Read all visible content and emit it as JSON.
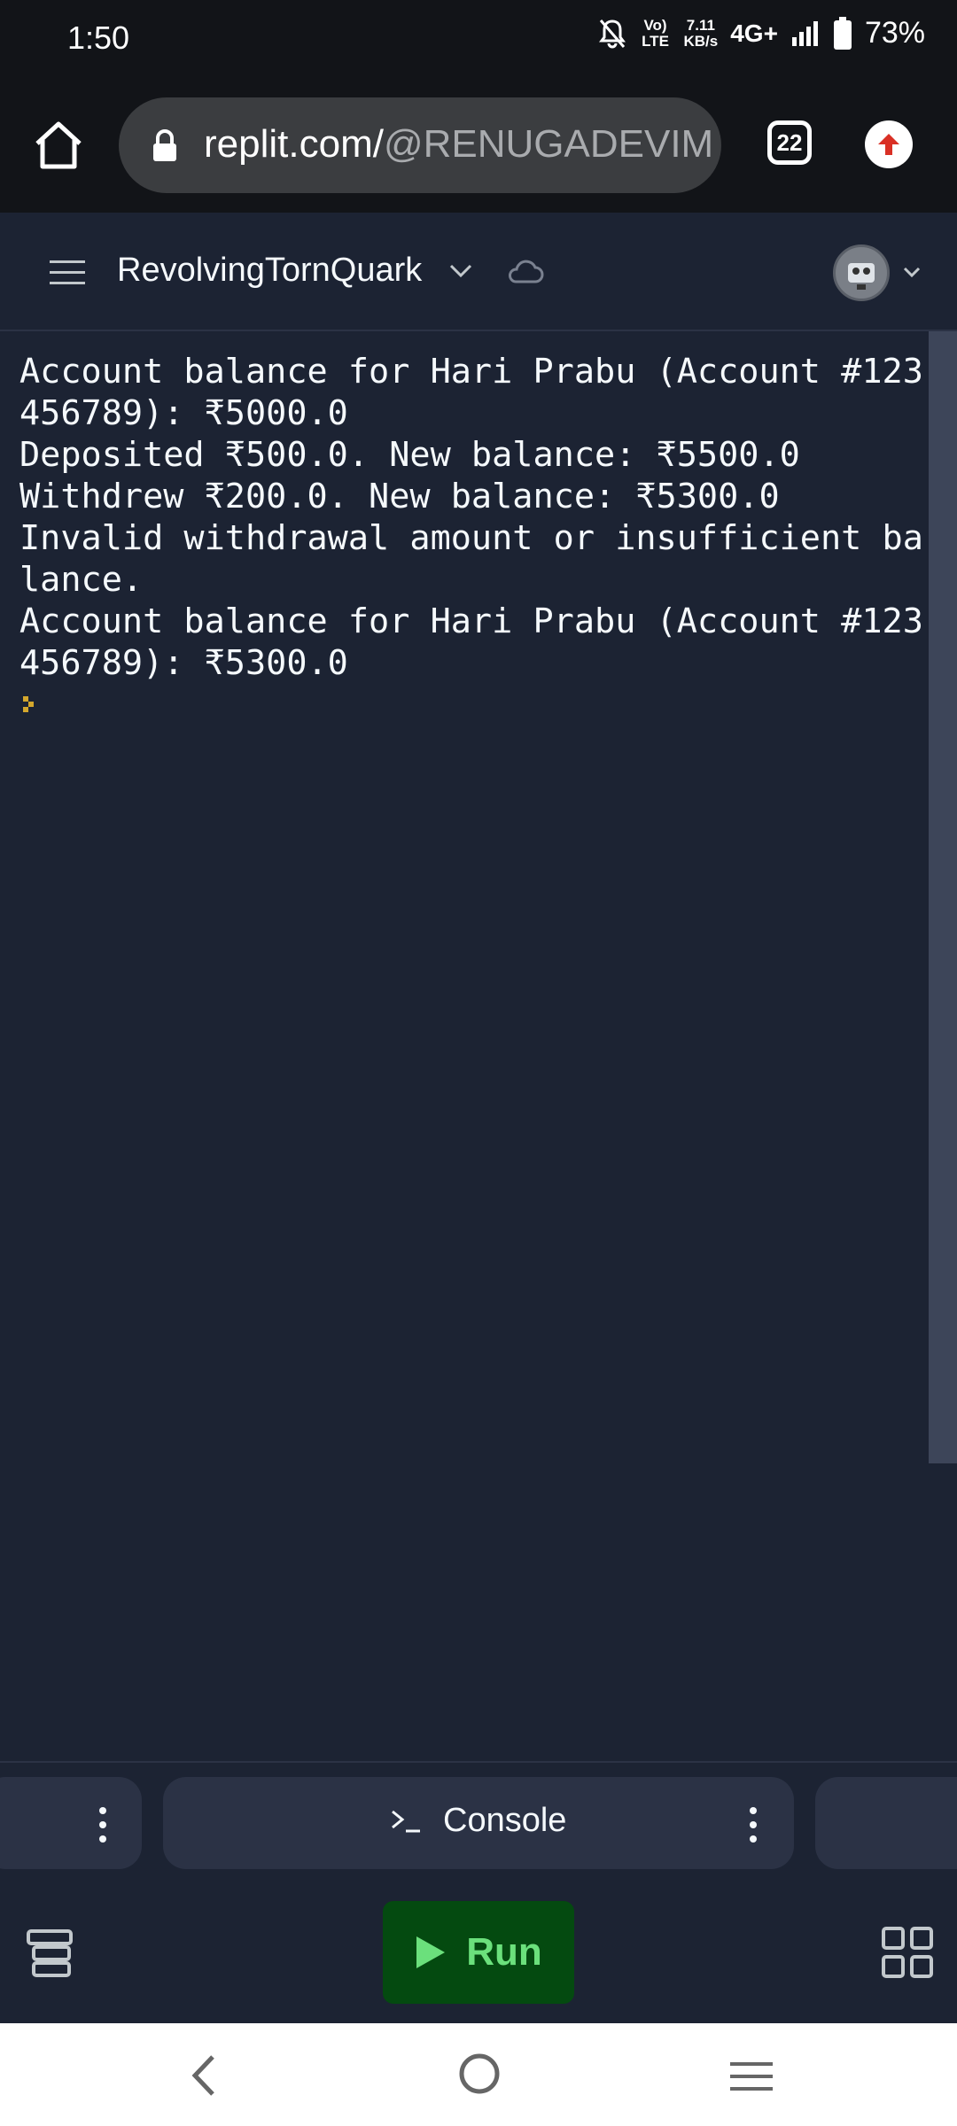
{
  "status_bar": {
    "time": "1:50",
    "volte": "Vo) LTE",
    "speed": "7.11",
    "speed_unit": "KB/s",
    "network": "4G+",
    "battery": "73%"
  },
  "browser": {
    "url_host": "replit.com/",
    "url_path": "@RENUGADEVIM",
    "tab_count": "22"
  },
  "app_header": {
    "project_name": "RevolvingTornQuark"
  },
  "console": {
    "lines": [
      "Account balance for Hari Prabu (Account #123",
      "456789): ₹5000.0",
      "Deposited ₹500.0. New balance: ₹5500.0",
      "Withdrew ₹200.0. New balance: ₹5300.0",
      "Invalid withdrawal amount or insufficient ba",
      "lance.",
      "Account balance for Hari Prabu (Account #123",
      "456789): ₹5300.0"
    ]
  },
  "tabs": {
    "console_label": "Console"
  },
  "actions": {
    "run_label": "Run"
  },
  "colors": {
    "background": "#1c2333",
    "run_button": "#044a10",
    "run_text": "#6be07c"
  }
}
